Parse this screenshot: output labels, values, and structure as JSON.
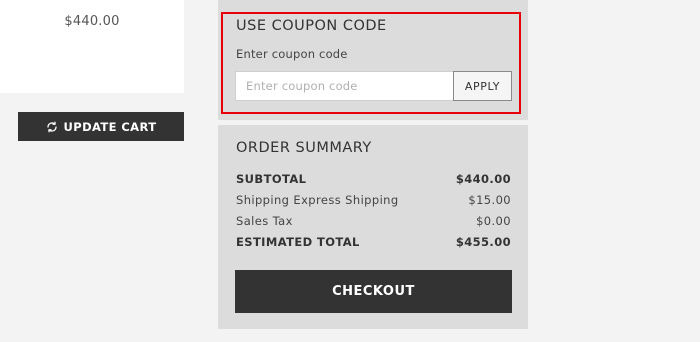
{
  "cart": {
    "item_price": "$440.00",
    "update_cart_label": "UPDATE CART",
    "update_icon": "refresh-icon"
  },
  "coupon": {
    "title": "USE COUPON CODE",
    "label": "Enter coupon code",
    "input_placeholder": "Enter coupon code",
    "input_value": "",
    "apply_label": "APPLY",
    "highlight_color": "#e8000b"
  },
  "summary": {
    "title": "ORDER SUMMARY",
    "rows": [
      {
        "label": "SUBTOTAL",
        "value": "$440.00"
      },
      {
        "label": "Shipping Express Shipping",
        "value": "$15.00"
      },
      {
        "label": "Sales Tax",
        "value": "$0.00"
      },
      {
        "label": "ESTIMATED TOTAL",
        "value": "$455.00"
      }
    ],
    "checkout_label": "CHECKOUT"
  }
}
